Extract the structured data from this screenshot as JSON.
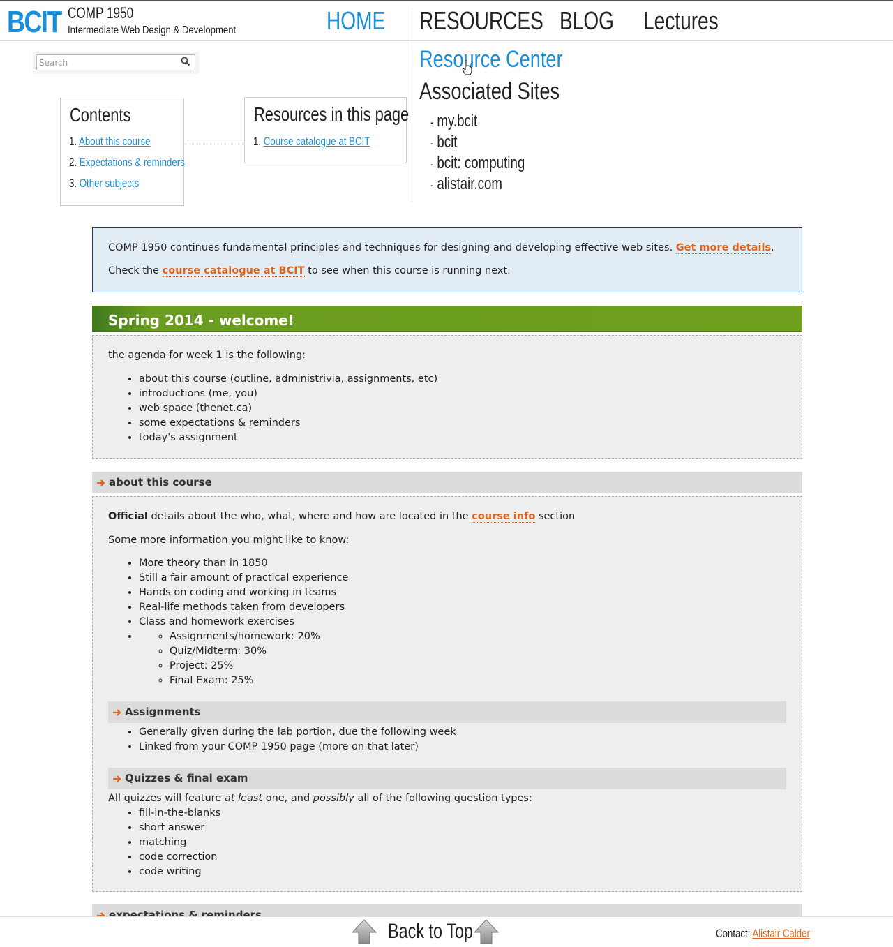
{
  "header": {
    "logo": "BCIT",
    "course_code": "COMP 1950",
    "course_subtitle": "Intermediate Web Design & Development",
    "nav": {
      "home": "HOME",
      "resources": "RESOURCES",
      "blog": "BLOG",
      "lectures": "Lectures"
    }
  },
  "search": {
    "placeholder": "Search"
  },
  "contents": {
    "title": "Contents",
    "items": [
      "About this course",
      "Expectations & reminders",
      "Other subjects"
    ]
  },
  "resources_box": {
    "title": "Resources in this page",
    "items": [
      "Course catalogue at BCIT"
    ]
  },
  "sidebar_right": {
    "resource_center": "Resource Center",
    "associated_title": "Associated Sites",
    "sites": [
      "my.bcit",
      "bcit",
      "bcit: computing",
      "alistair.com"
    ]
  },
  "intro": {
    "line1_text": "COMP 1950 continues fundamental principles and techniques for designing and developing effective web sites.",
    "line1_link": "Get more details",
    "line2_pre": "Check the",
    "line2_link": "course catalogue at BCIT",
    "line2_post": "to see when this course is running next."
  },
  "welcome": {
    "title": "Spring 2014 - welcome!",
    "agenda_intro": "the agenda for week 1 is the following:",
    "agenda": [
      "about this course (outline, administrivia, assignments, etc)",
      "introductions (me, you)",
      "web space (thenet.ca)",
      "some expectations & reminders",
      "today's assignment"
    ]
  },
  "about": {
    "title": "about this course",
    "official_bold": "Official",
    "official_text": "details about the who, what, where and how are located in the",
    "official_link": "course info",
    "official_post": "section",
    "more_info": "Some more information you might like to know:",
    "points": [
      "More theory than in 1850",
      "Still a fair amount of practical experience",
      "Hands on coding and working in teams",
      "Real-life methods taken from developers",
      "Class and homework exercises"
    ],
    "grading": [
      "Assignments/homework: 20%",
      "Quiz/Midterm: 30%",
      "Project: 25%",
      "Final Exam: 25%"
    ],
    "assignments_title": "Assignments",
    "assignments": [
      "Generally given during the lab portion, due the following week",
      "Linked from your COMP 1950 page (more on that later)"
    ],
    "quizzes_title": "Quizzes & final exam",
    "quizzes_pre": "All quizzes will feature",
    "quizzes_em1": "at least",
    "quizzes_mid": "one, and",
    "quizzes_em2": "possibly",
    "quizzes_post": "all of the following question types:",
    "question_types": [
      "fill-in-the-blanks",
      "short answer",
      "matching",
      "code correction",
      "code writing"
    ]
  },
  "expectations": {
    "title": "expectations & reminders"
  },
  "footer": {
    "back_to_top": "Back to Top",
    "contact_label": "Contact:",
    "contact_name": "Alistair Calder"
  },
  "colors": {
    "accent_blue": "#1a8fd8",
    "link_orange": "#e0641c",
    "welcome_green": "#6fa01e",
    "intro_bg": "#e3edf6"
  }
}
